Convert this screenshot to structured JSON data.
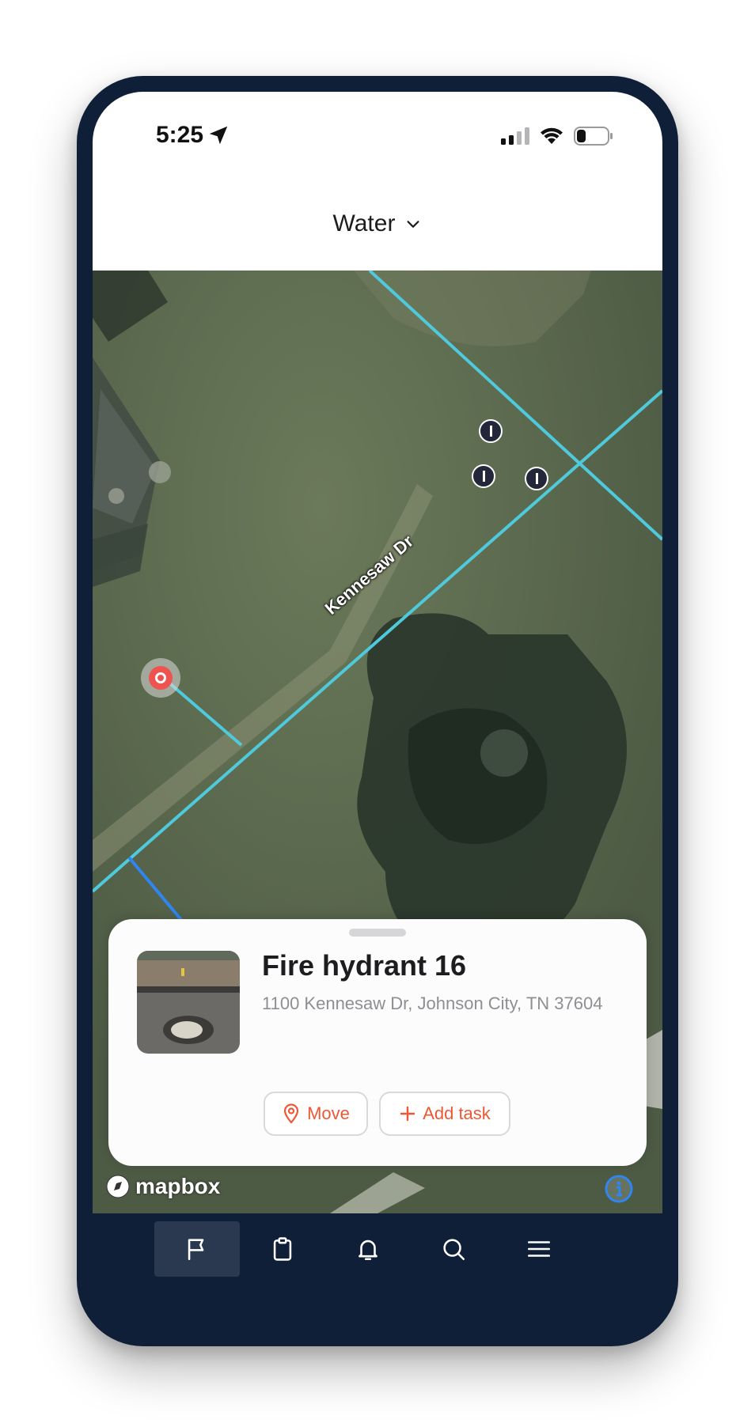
{
  "status_bar": {
    "time": "5:25",
    "icons": [
      "location-arrow-icon",
      "signal-icon",
      "wifi-icon",
      "battery-icon"
    ]
  },
  "header": {
    "layer_label": "Water",
    "dropdown_icon": "chevron-down-icon"
  },
  "map": {
    "street_label": "Kennesaw Dr",
    "attribution": "mapbox",
    "line_color": "#4fc9dc",
    "service_line_color": "#2f86f0",
    "selected_marker_color": "#ef5350",
    "valve_marker_color": "#22283a"
  },
  "feature_sheet": {
    "title": "Fire hydrant 16",
    "address": "1100 Kennesaw Dr, Johnson City, TN 37604",
    "actions": {
      "move_label": "Move",
      "move_icon": "map-pin-icon",
      "add_task_label": "Add task",
      "add_task_icon": "plus-icon"
    },
    "accent_color": "#ef5734"
  },
  "tab_bar": {
    "tabs": [
      {
        "icon": "flag-icon",
        "active": true
      },
      {
        "icon": "clipboard-icon",
        "active": false
      },
      {
        "icon": "bell-icon",
        "active": false
      },
      {
        "icon": "search-icon",
        "active": false
      },
      {
        "icon": "menu-icon",
        "active": false
      }
    ]
  }
}
